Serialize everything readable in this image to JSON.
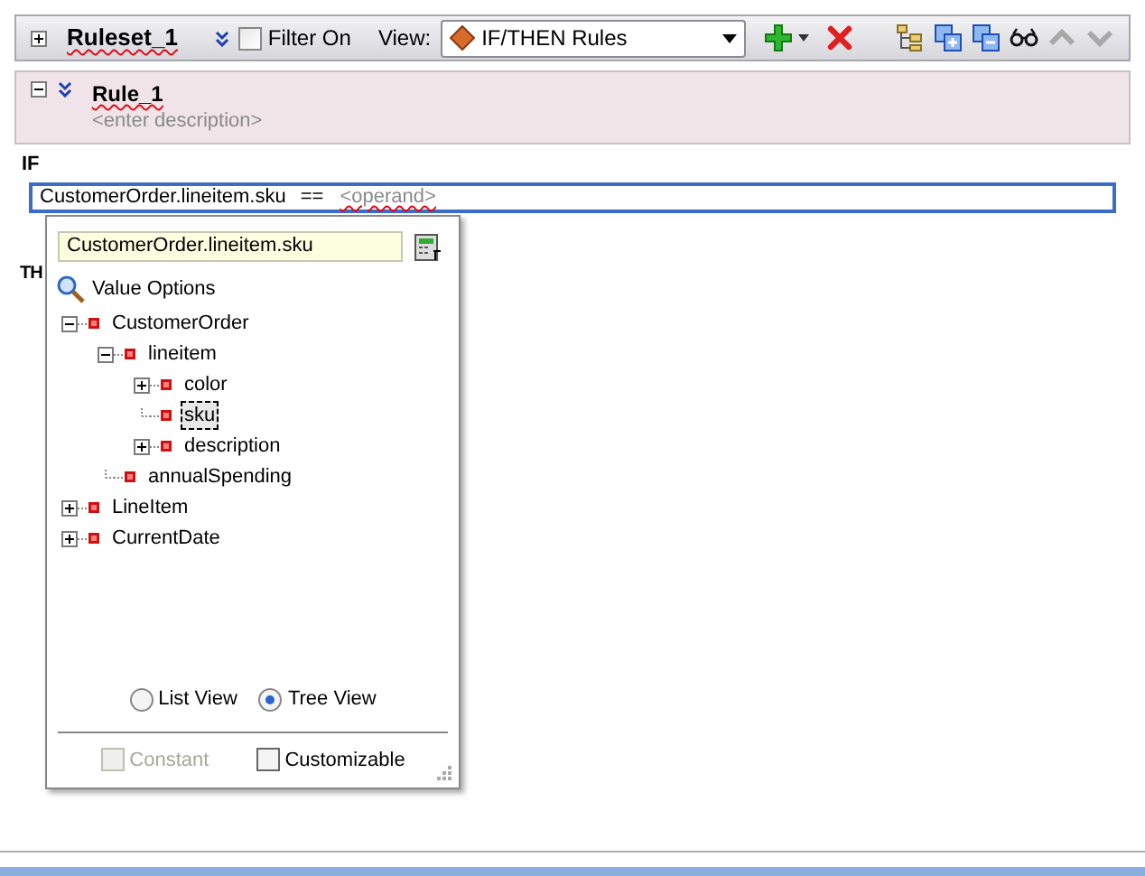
{
  "ruleset": {
    "expanded": false,
    "name": "Ruleset_1",
    "filter": {
      "label": "Filter On",
      "checked": false
    },
    "view_label": "View:",
    "view_value": "IF/THEN Rules"
  },
  "rule": {
    "expanded": true,
    "name": "Rule_1",
    "description": "<enter description>"
  },
  "if_label": "IF",
  "condition": {
    "left": "CustomerOrder.lineitem.sku",
    "operator": "==",
    "operand": "<operand>"
  },
  "then_label": "TH",
  "popup": {
    "value": "CustomerOrder.lineitem.sku",
    "title": "Value Options",
    "tree": [
      {
        "label": "CustomerOrder",
        "expanded": true,
        "selected": false,
        "children": [
          {
            "label": "lineitem",
            "expanded": true,
            "selected": false,
            "children": [
              {
                "label": "color",
                "expanded": false,
                "selected": false
              },
              {
                "label": "sku",
                "selected": true
              },
              {
                "label": "description",
                "expanded": false,
                "selected": false
              }
            ]
          },
          {
            "label": "annualSpending",
            "selected": false
          }
        ]
      },
      {
        "label": "LineItem",
        "expanded": false,
        "selected": false
      },
      {
        "label": "CurrentDate",
        "expanded": false,
        "selected": false
      }
    ],
    "views": [
      {
        "label": "List View",
        "selected": false
      },
      {
        "label": "Tree View",
        "selected": true
      }
    ],
    "options": [
      {
        "label": "Constant",
        "checked": false,
        "disabled": true
      },
      {
        "label": "Customizable",
        "checked": false,
        "disabled": false
      }
    ]
  }
}
